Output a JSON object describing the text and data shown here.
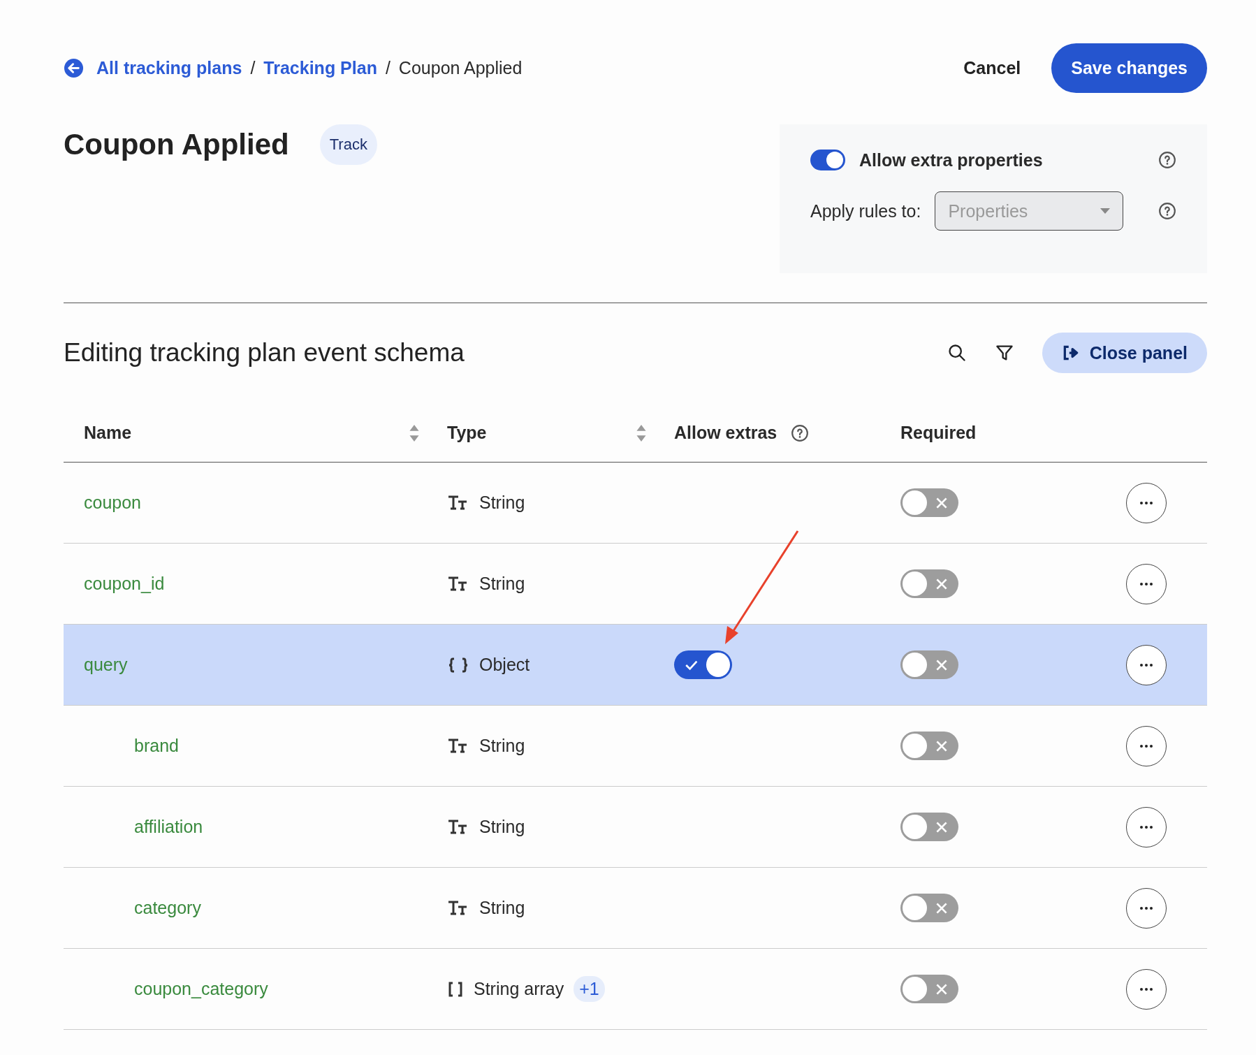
{
  "breadcrumbs": [
    {
      "label": "All tracking plans",
      "link": true
    },
    {
      "prefix": "/",
      "label": "Tracking Plan",
      "link": true
    },
    {
      "prefix": "/",
      "label": "Coupon Applied",
      "link": false
    }
  ],
  "actions": {
    "cancel": "Cancel",
    "save": "Save changes"
  },
  "title": "Coupon Applied",
  "badge": "Track",
  "settings": {
    "allow_extra": {
      "label": "Allow extra properties",
      "on": true
    },
    "apply_rules": {
      "label": "Apply rules to:",
      "value": "Properties",
      "disabled": true
    }
  },
  "schema": {
    "heading": "Editing tracking plan event schema",
    "close_button": "Close panel",
    "columns": [
      {
        "label": "Name",
        "sortable": true,
        "help": false
      },
      {
        "label": "Type",
        "sortable": true,
        "help": false
      },
      {
        "label": "Allow extras",
        "sortable": false,
        "help": true
      },
      {
        "label": "Required",
        "sortable": false,
        "help": false
      }
    ],
    "rows": [
      {
        "name": "coupon",
        "type": "String",
        "kind": "string",
        "required": false,
        "selected": false
      },
      {
        "name": "coupon_id",
        "type": "String",
        "kind": "string",
        "required": false,
        "selected": false
      },
      {
        "name": "query",
        "type": "Object",
        "kind": "object",
        "allow_extras": true,
        "required": false,
        "selected": true,
        "children": [
          {
            "name": "brand",
            "type": "String",
            "kind": "string",
            "required": false,
            "selected": false
          },
          {
            "name": "affiliation",
            "type": "String",
            "kind": "string",
            "required": false,
            "selected": false
          },
          {
            "name": "category",
            "type": "String",
            "kind": "string",
            "required": false,
            "selected": false
          },
          {
            "name": "coupon_category",
            "type": "String array",
            "kind": "array",
            "extra_count": "+1",
            "required": false,
            "selected": false
          }
        ]
      }
    ]
  }
}
